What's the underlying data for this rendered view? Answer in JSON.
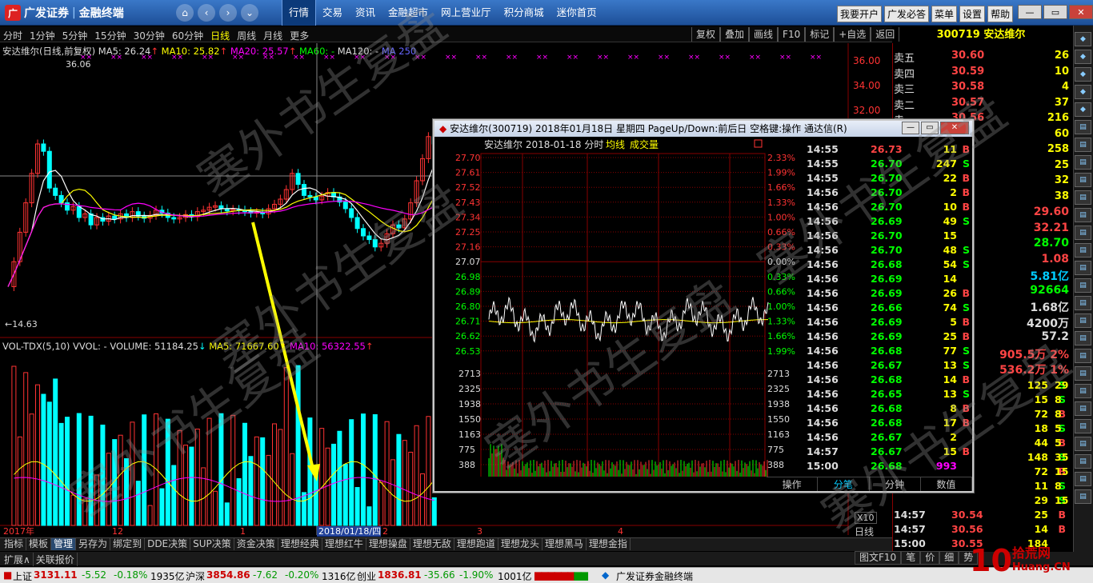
{
  "app": {
    "logo": "广发证券",
    "subtitle": "金融终端"
  },
  "nav": {
    "main": [
      "行情",
      "交易",
      "资讯",
      "金融超市",
      "网上营业厅",
      "积分商城",
      "迷你首页"
    ],
    "active_index": 0,
    "right": [
      "我要开户",
      "广发必答",
      "菜单",
      "设置",
      "帮助"
    ],
    "window": [
      "—",
      "▭",
      "✕"
    ]
  },
  "timeframes": [
    "分时",
    "1分钟",
    "5分钟",
    "15分钟",
    "30分钟",
    "60分钟",
    "日线",
    "周线",
    "月线",
    "更多"
  ],
  "timeframe_active": 6,
  "tools": [
    "复权",
    "叠加",
    "画线",
    "F10",
    "标记",
    "+自选",
    "返回"
  ],
  "stock": {
    "code": "300719",
    "name": "安达维尔"
  },
  "ma_legend": {
    "name": "安达维尔(日线,前复权)",
    "ma5": "MA5: 26.24",
    "ma10": "MA10: 25.82",
    "ma20": "MA20: 25.57",
    "ma60": "MA60: -",
    "ma120": "MA120: -",
    "ma250": "MA 250"
  },
  "vol_legend": {
    "name": "VOL-TDX(5,10)",
    "vvol": "VVOL: -",
    "volume": "VOLUME: 51184.25",
    "ma5": "MA5: 71667.60",
    "ma10": "MA10: 56322.55"
  },
  "kline_prices": {
    "high": "36.06",
    "low": "14.63"
  },
  "price_axis": [
    "36.00",
    "34.00",
    "32.00"
  ],
  "date_axis": [
    "2017年",
    "12",
    "1",
    "2018/01/18/四",
    "2",
    "3",
    "4"
  ],
  "orderbook": [
    {
      "label": "卖五",
      "price": "30.60",
      "vol": "26"
    },
    {
      "label": "卖四",
      "price": "30.59",
      "vol": "10"
    },
    {
      "label": "卖三",
      "price": "30.58",
      "vol": "4"
    },
    {
      "label": "卖二",
      "price": "30.57",
      "vol": "37"
    },
    {
      "label": "卖一",
      "price": "30.56",
      "vol": "216"
    },
    {
      "label": "",
      "price": "",
      "vol": "60"
    },
    {
      "label": "",
      "price": "",
      "vol": "258"
    },
    {
      "label": "",
      "price": "",
      "vol": "25"
    },
    {
      "label": "",
      "price": "",
      "vol": "32"
    },
    {
      "label": "",
      "price": "",
      "vol": "38"
    }
  ],
  "stats": [
    {
      "label": "今开",
      "value": "29.60",
      "color": "#f44"
    },
    {
      "label": "最高",
      "value": "32.21",
      "color": "#f44"
    },
    {
      "label": "最低",
      "value": "28.70",
      "color": "#0f0"
    },
    {
      "label": "量比",
      "value": "1.08",
      "color": "#f44"
    },
    {
      "label": "总额",
      "value": "5.81亿",
      "color": "#0cf"
    },
    {
      "label": "内盘",
      "value": "92664",
      "color": "#0f0"
    },
    {
      "label": "股本",
      "value": "1.68亿",
      "color": "#ddd"
    },
    {
      "label": "流通",
      "value": "4200万",
      "color": "#ddd"
    },
    {
      "label": "PE(动)",
      "value": "57.2",
      "color": "#ddd"
    },
    {
      "label": "",
      "value": "905.5万   2%",
      "color": "#f44"
    },
    {
      "label": "",
      "value": "536.2万   1%",
      "color": "#f44"
    }
  ],
  "right_ticks": [
    {
      "t": "",
      "p": "",
      "v": "125",
      "bs": "S",
      "pc": "#0f0"
    },
    {
      "t": "",
      "p": "",
      "v": "15",
      "bs": "S",
      "pc": "#0f0"
    },
    {
      "t": "",
      "p": "",
      "v": "72",
      "bs": "B",
      "pc": "#f44"
    },
    {
      "t": "",
      "p": "",
      "v": "18",
      "bs": "S",
      "pc": "#0f0"
    },
    {
      "t": "",
      "p": "",
      "v": "44",
      "bs": "B",
      "pc": "#f44"
    },
    {
      "t": "",
      "p": "",
      "v": "148",
      "bs": "S",
      "pc": "#0f0"
    },
    {
      "t": "",
      "p": "",
      "v": "72",
      "bs": "B",
      "pc": "#f44"
    },
    {
      "t": "",
      "p": "",
      "v": "11",
      "bs": "S",
      "pc": "#0f0"
    },
    {
      "t": "",
      "p": "",
      "v": "29",
      "bs": "S",
      "pc": "#0f0"
    },
    {
      "t": "14:57",
      "p": "30.54",
      "v": "25",
      "bs": "B",
      "pc": "#f44"
    },
    {
      "t": "14:57",
      "p": "30.56",
      "v": "14",
      "bs": "B",
      "pc": "#f44"
    },
    {
      "t": "15:00",
      "p": "30.55",
      "v": "184",
      "bs": "",
      "pc": "#f44"
    }
  ],
  "right_vols": [
    "29",
    "8",
    "8",
    "5",
    "5",
    "35",
    "15",
    "8",
    "15"
  ],
  "right_tabs": [
    "笔",
    "价",
    "细",
    "势"
  ],
  "right_top_tab": "图文F10",
  "daily_label": "日线",
  "x10_label": "X10",
  "bottom_tabs": [
    "指标",
    "模板",
    "管理",
    "另存为",
    "绑定到",
    "DDE决策",
    "SUP决策",
    "资金决策",
    "理想经典",
    "理想红牛",
    "理想操盘",
    "理想无敌",
    "理想跑道",
    "理想龙头",
    "理想黑马",
    "理想金指"
  ],
  "bottom_active": 2,
  "expand_tabs": [
    "扩展∧",
    "关联报价"
  ],
  "status": {
    "sh_label": "上证",
    "sh": "3131.11",
    "sh_chg": "-5.52",
    "sh_pct": "-0.18%",
    "sh_amt": "1935亿",
    "sz_label": "沪深",
    "sz": "3854.86",
    "sz_chg": "-7.62",
    "sz_pct": "-0.20%",
    "sz_amt": "1316亿",
    "cy_label": "创业",
    "cy": "1836.81",
    "cy_chg": "-35.66",
    "cy_pct": "-1.90%",
    "cy_amt": "1001亿",
    "app": "广发证券金融终端"
  },
  "watermark": {
    "text": "塞外书生复盘",
    "site_num": "10",
    "site_name": "拾荒网",
    "site_url": "Huang.CN"
  },
  "popup": {
    "title": "安达维尔(300719) 2018年01月18日 星期四 PageUp/Down:前后日 空格键:操作 通达信(R)",
    "header": "安达维尔  2018-01-18 分时",
    "header_avg": "均线",
    "header_vol": "成交量",
    "prices": [
      "27.70",
      "27.61",
      "27.52",
      "27.43",
      "27.34",
      "27.25",
      "27.16",
      "27.07",
      "26.98",
      "26.89",
      "26.80",
      "26.71",
      "26.62",
      "26.53"
    ],
    "pcts": [
      "2.33%",
      "1.99%",
      "1.66%",
      "1.33%",
      "1.00%",
      "0.66%",
      "0.33%",
      "0.00%",
      "0.33%",
      "0.66%",
      "1.00%",
      "1.33%",
      "1.66%",
      "1.99%"
    ],
    "vol_axis": [
      "2713",
      "2325",
      "1938",
      "1550",
      "1163",
      "775",
      "388"
    ],
    "time_axis": [
      "09:30",
      "10:30",
      "13:00",
      "14:00"
    ],
    "bottom_tabs": [
      "操作",
      "分笔",
      "分钟",
      "数值"
    ],
    "bottom_active": 1,
    "ticks": [
      {
        "t": "14:55",
        "p": "26.73",
        "v": "11",
        "bs": "B",
        "pc": "#f44"
      },
      {
        "t": "14:55",
        "p": "26.70",
        "v": "247",
        "bs": "S",
        "pc": "#0f0"
      },
      {
        "t": "14:55",
        "p": "26.70",
        "v": "22",
        "bs": "B",
        "pc": "#0f0"
      },
      {
        "t": "14:56",
        "p": "26.70",
        "v": "2",
        "bs": "B",
        "pc": "#0f0"
      },
      {
        "t": "14:56",
        "p": "26.70",
        "v": "10",
        "bs": "B",
        "pc": "#0f0"
      },
      {
        "t": "14:56",
        "p": "26.69",
        "v": "49",
        "bs": "S",
        "pc": "#0f0"
      },
      {
        "t": "14:56",
        "p": "26.70",
        "v": "15",
        "bs": "",
        "pc": "#0f0"
      },
      {
        "t": "14:56",
        "p": "26.70",
        "v": "48",
        "bs": "S",
        "pc": "#0f0"
      },
      {
        "t": "14:56",
        "p": "26.68",
        "v": "54",
        "bs": "S",
        "pc": "#0f0"
      },
      {
        "t": "14:56",
        "p": "26.69",
        "v": "14",
        "bs": "",
        "pc": "#0f0"
      },
      {
        "t": "14:56",
        "p": "26.69",
        "v": "26",
        "bs": "B",
        "pc": "#0f0"
      },
      {
        "t": "14:56",
        "p": "26.66",
        "v": "74",
        "bs": "S",
        "pc": "#0f0"
      },
      {
        "t": "14:56",
        "p": "26.69",
        "v": "5",
        "bs": "B",
        "pc": "#0f0"
      },
      {
        "t": "14:56",
        "p": "26.69",
        "v": "25",
        "bs": "B",
        "pc": "#0f0"
      },
      {
        "t": "14:56",
        "p": "26.68",
        "v": "77",
        "bs": "S",
        "pc": "#0f0"
      },
      {
        "t": "14:56",
        "p": "26.67",
        "v": "13",
        "bs": "S",
        "pc": "#0f0"
      },
      {
        "t": "14:56",
        "p": "26.68",
        "v": "14",
        "bs": "B",
        "pc": "#0f0"
      },
      {
        "t": "14:56",
        "p": "26.65",
        "v": "13",
        "bs": "S",
        "pc": "#0f0"
      },
      {
        "t": "14:56",
        "p": "26.68",
        "v": "8",
        "bs": "B",
        "pc": "#0f0"
      },
      {
        "t": "14:56",
        "p": "26.68",
        "v": "17",
        "bs": "B",
        "pc": "#0f0"
      },
      {
        "t": "14:56",
        "p": "26.67",
        "v": "2",
        "bs": "",
        "pc": "#0f0"
      },
      {
        "t": "14:57",
        "p": "26.67",
        "v": "15",
        "bs": "B",
        "pc": "#0f0"
      },
      {
        "t": "15:00",
        "p": "26.68",
        "v": "993",
        "bs": "",
        "pc": "#0f0"
      }
    ]
  },
  "colors": {
    "up": "#f33",
    "down": "#0ff",
    "ma5": "#ffffff",
    "ma10": "#ffff00",
    "ma20": "#ff00ff",
    "accent": "#1d4f98"
  }
}
